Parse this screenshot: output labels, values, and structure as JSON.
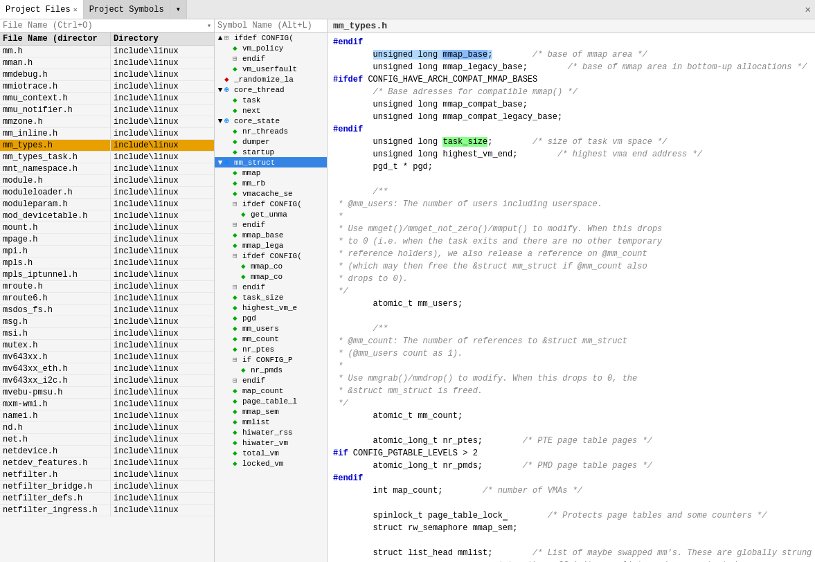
{
  "tabs": [
    {
      "label": "Project Files",
      "active": true,
      "closable": true
    },
    {
      "label": "Project Symbols",
      "active": false,
      "closable": false
    },
    {
      "label": "▾",
      "active": false,
      "closable": false
    }
  ],
  "file_search": {
    "placeholder": "File Name (Ctrl+O)"
  },
  "file_table": {
    "col_name": "File Name (director",
    "col_dir": "Directory",
    "rows": [
      {
        "name": "mm.h",
        "dir": "include\\linux",
        "selected": false
      },
      {
        "name": "mman.h",
        "dir": "include\\linux",
        "selected": false
      },
      {
        "name": "mmdebug.h",
        "dir": "include\\linux",
        "selected": false
      },
      {
        "name": "mmiotrace.h",
        "dir": "include\\linux",
        "selected": false
      },
      {
        "name": "mmu_context.h",
        "dir": "include\\linux",
        "selected": false
      },
      {
        "name": "mmu_notifier.h",
        "dir": "include\\linux",
        "selected": false
      },
      {
        "name": "mmzone.h",
        "dir": "include\\linux",
        "selected": false
      },
      {
        "name": "mm_inline.h",
        "dir": "include\\linux",
        "selected": false
      },
      {
        "name": "mm_types.h",
        "dir": "include\\linux",
        "selected": true
      },
      {
        "name": "mm_types_task.h",
        "dir": "include\\linux",
        "selected": false
      },
      {
        "name": "mnt_namespace.h",
        "dir": "include\\linux",
        "selected": false
      },
      {
        "name": "module.h",
        "dir": "include\\linux",
        "selected": false
      },
      {
        "name": "moduleloader.h",
        "dir": "include\\linux",
        "selected": false
      },
      {
        "name": "moduleparam.h",
        "dir": "include\\linux",
        "selected": false
      },
      {
        "name": "mod_devicetable.h",
        "dir": "include\\linux",
        "selected": false
      },
      {
        "name": "mount.h",
        "dir": "include\\linux",
        "selected": false
      },
      {
        "name": "mpage.h",
        "dir": "include\\linux",
        "selected": false
      },
      {
        "name": "mpi.h",
        "dir": "include\\linux",
        "selected": false
      },
      {
        "name": "mpls.h",
        "dir": "include\\linux",
        "selected": false
      },
      {
        "name": "mpls_iptunnel.h",
        "dir": "include\\linux",
        "selected": false
      },
      {
        "name": "mroute.h",
        "dir": "include\\linux",
        "selected": false
      },
      {
        "name": "mroute6.h",
        "dir": "include\\linux",
        "selected": false
      },
      {
        "name": "msdos_fs.h",
        "dir": "include\\linux",
        "selected": false
      },
      {
        "name": "msg.h",
        "dir": "include\\linux",
        "selected": false
      },
      {
        "name": "msi.h",
        "dir": "include\\linux",
        "selected": false
      },
      {
        "name": "mutex.h",
        "dir": "include\\linux",
        "selected": false
      },
      {
        "name": "mv643xx.h",
        "dir": "include\\linux",
        "selected": false
      },
      {
        "name": "mv643xx_eth.h",
        "dir": "include\\linux",
        "selected": false
      },
      {
        "name": "mv643xx_i2c.h",
        "dir": "include\\linux",
        "selected": false
      },
      {
        "name": "mvebu-pmsu.h",
        "dir": "include\\linux",
        "selected": false
      },
      {
        "name": "mxm-wmi.h",
        "dir": "include\\linux",
        "selected": false
      },
      {
        "name": "namei.h",
        "dir": "include\\linux",
        "selected": false
      },
      {
        "name": "nd.h",
        "dir": "include\\linux",
        "selected": false
      },
      {
        "name": "net.h",
        "dir": "include\\linux",
        "selected": false
      },
      {
        "name": "netdevice.h",
        "dir": "include\\linux",
        "selected": false
      },
      {
        "name": "netdev_features.h",
        "dir": "include\\linux",
        "selected": false
      },
      {
        "name": "netfilter.h",
        "dir": "include\\linux",
        "selected": false
      },
      {
        "name": "netfilter_bridge.h",
        "dir": "include\\linux",
        "selected": false
      },
      {
        "name": "netfilter_defs.h",
        "dir": "include\\linux",
        "selected": false
      },
      {
        "name": "netfilter_ingress.h",
        "dir": "include\\linux",
        "selected": false
      }
    ]
  },
  "symbol_search": {
    "placeholder": "Symbol Name (Alt+L)"
  },
  "symbol_tree": [
    {
      "level": 1,
      "type": "ifdef",
      "label": "ifdef CONFIG(",
      "toggle": "▲",
      "icon": "⊞"
    },
    {
      "level": 2,
      "type": "field_green",
      "label": "vm_policy",
      "toggle": "",
      "icon": "◆"
    },
    {
      "level": 2,
      "type": "ifdef",
      "label": "endif",
      "toggle": "",
      "icon": "⊞"
    },
    {
      "level": 2,
      "type": "field_green",
      "label": "vm_userfault",
      "toggle": "",
      "icon": "◆"
    },
    {
      "level": 1,
      "type": "red",
      "label": "_randomize_la",
      "toggle": "",
      "icon": "◆"
    },
    {
      "level": 1,
      "type": "struct_blue",
      "label": "core_thread",
      "toggle": "▼",
      "icon": "⊕"
    },
    {
      "level": 2,
      "type": "field_green",
      "label": "task",
      "toggle": "",
      "icon": "◆"
    },
    {
      "level": 2,
      "type": "field_green",
      "label": "next",
      "toggle": "",
      "icon": "◆"
    },
    {
      "level": 1,
      "type": "struct_blue",
      "label": "core_state",
      "toggle": "▼",
      "icon": "⊕"
    },
    {
      "level": 2,
      "type": "field_green",
      "label": "nr_threads",
      "toggle": "",
      "icon": "◆"
    },
    {
      "level": 2,
      "type": "field_green",
      "label": "dumper",
      "toggle": "",
      "icon": "◆"
    },
    {
      "level": 2,
      "type": "field_green",
      "label": "startup",
      "toggle": "",
      "icon": "◆"
    },
    {
      "level": 1,
      "type": "struct_blue_selected",
      "label": "mm_struct",
      "toggle": "▼",
      "icon": "⊕"
    },
    {
      "level": 2,
      "type": "field_green",
      "label": "mmap",
      "toggle": "",
      "icon": "◆"
    },
    {
      "level": 2,
      "type": "field_green",
      "label": "mm_rb",
      "toggle": "",
      "icon": "◆"
    },
    {
      "level": 2,
      "type": "field_green",
      "label": "vmacache_se",
      "toggle": "",
      "icon": "◆"
    },
    {
      "level": 2,
      "type": "ifdef",
      "label": "ifdef CONFIG(",
      "toggle": "",
      "icon": "⊞"
    },
    {
      "level": 3,
      "type": "field_green",
      "label": "get_unma",
      "toggle": "",
      "icon": "◆"
    },
    {
      "level": 2,
      "type": "ifdef",
      "label": "endif",
      "toggle": "",
      "icon": "⊞"
    },
    {
      "level": 2,
      "type": "field_green",
      "label": "mmap_base",
      "toggle": "",
      "icon": "◆"
    },
    {
      "level": 2,
      "type": "field_green",
      "label": "mmap_lega",
      "toggle": "",
      "icon": "◆"
    },
    {
      "level": 2,
      "type": "ifdef",
      "label": "ifdef CONFIG(",
      "toggle": "",
      "icon": "⊞"
    },
    {
      "level": 3,
      "type": "field_green",
      "label": "mmap_co",
      "toggle": "",
      "icon": "◆"
    },
    {
      "level": 3,
      "type": "field_green",
      "label": "mmap_co",
      "toggle": "",
      "icon": "◆"
    },
    {
      "level": 2,
      "type": "ifdef",
      "label": "endif",
      "toggle": "",
      "icon": "⊞"
    },
    {
      "level": 2,
      "type": "field_green",
      "label": "task_size",
      "toggle": "",
      "icon": "◆"
    },
    {
      "level": 2,
      "type": "field_green",
      "label": "highest_vm_e",
      "toggle": "",
      "icon": "◆"
    },
    {
      "level": 2,
      "type": "field_green",
      "label": "pgd",
      "toggle": "",
      "icon": "◆"
    },
    {
      "level": 2,
      "type": "field_green",
      "label": "mm_users",
      "toggle": "",
      "icon": "◆"
    },
    {
      "level": 2,
      "type": "field_green",
      "label": "mm_count",
      "toggle": "",
      "icon": "◆"
    },
    {
      "level": 2,
      "type": "field_green",
      "label": "nr_ptes",
      "toggle": "",
      "icon": "◆"
    },
    {
      "level": 2,
      "type": "ifdef",
      "label": "if CONFIG_P",
      "toggle": "",
      "icon": "⊞"
    },
    {
      "level": 3,
      "type": "field_green",
      "label": "nr_pmds",
      "toggle": "",
      "icon": "◆"
    },
    {
      "level": 2,
      "type": "ifdef",
      "label": "endif",
      "toggle": "",
      "icon": "⊞"
    },
    {
      "level": 2,
      "type": "field_green",
      "label": "map_count",
      "toggle": "",
      "icon": "◆"
    },
    {
      "level": 2,
      "type": "field_green",
      "label": "page_table_l",
      "toggle": "",
      "icon": "◆"
    },
    {
      "level": 2,
      "type": "field_green",
      "label": "mmap_sem",
      "toggle": "",
      "icon": "◆"
    },
    {
      "level": 2,
      "type": "field_green",
      "label": "mmlist",
      "toggle": "",
      "icon": "◆"
    },
    {
      "level": 2,
      "type": "field_green",
      "label": "hiwater_rss",
      "toggle": "",
      "icon": "◆"
    },
    {
      "level": 2,
      "type": "field_green",
      "label": "hiwater_vm",
      "toggle": "",
      "icon": "◆"
    },
    {
      "level": 2,
      "type": "field_green",
      "label": "total_vm",
      "toggle": "",
      "icon": "◆"
    },
    {
      "level": 2,
      "type": "field_green",
      "label": "locked_vm",
      "toggle": "",
      "icon": "◆"
    }
  ],
  "code": {
    "title": "mm_types.h",
    "content_url": "https://blog.csdn.net/...",
    "lines": []
  }
}
